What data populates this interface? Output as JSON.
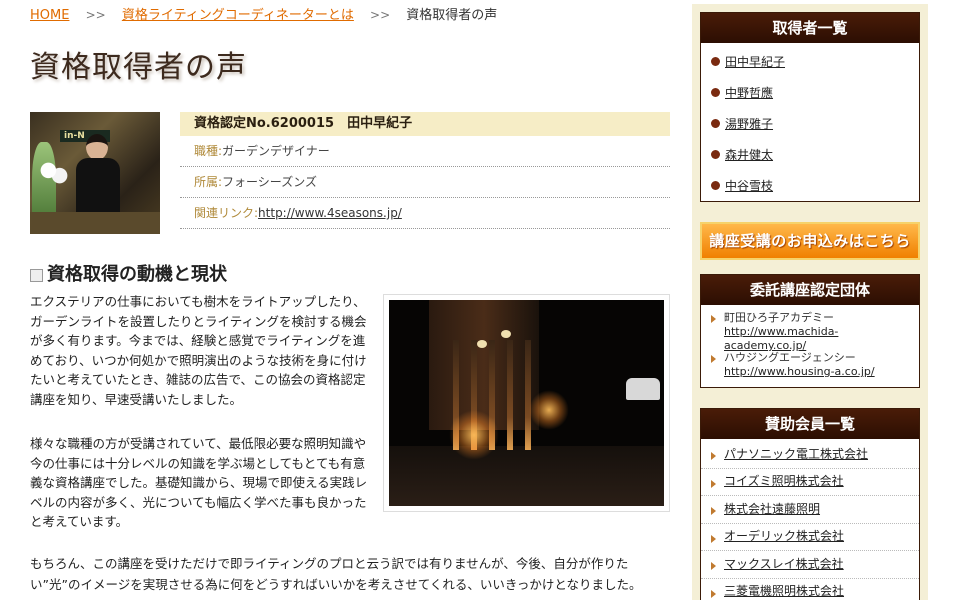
{
  "breadcrumb": {
    "home": "HOME",
    "parent": "資格ライティングコーディネーターとは",
    "current": "資格取得者の声",
    "separator": ">>"
  },
  "page_title": "資格取得者の声",
  "profile": {
    "name_line": "資格認定No.6200015　田中早紀子",
    "occupation_label": "職種:",
    "occupation_value": "ガーデンデザイナー",
    "affiliation_label": "所属:",
    "affiliation_value": "フォーシーズンズ",
    "link_label": "関連リンク:",
    "link_url": "http://www.4seasons.jp/",
    "photo_sign": "in-N"
  },
  "section": {
    "heading": "資格取得の動機と現状",
    "paragraph1": "エクステリアの仕事においても樹木をライトアップしたり、ガーデンライトを設置したりとライティングを検討する機会が多く有ります。今までは、経験と感覚でライティングを進めており、いつか何処かで照明演出のような技術を身に付けたいと考えていたとき、雑誌の広告で、この協会の資格認定講座を知り、早速受講いたしました。",
    "paragraph2": "様々な職種の方が受講されていて、最低限必要な照明知識や今の仕事には十分レベルの知識を学ぶ場としてもとても有意義な資格講座でした。基礎知識から、現場で即使える実践レベルの内容が多く、光についても幅広く学べた事も良かったと考えています。",
    "paragraph3": "もちろん、この講座を受けただけで即ライティングのプロと云う訳では有りませんが、今後、自分が作りたい”光”のイメージを実現させる為に何をどうすればいいかを考えさせてくれる、いいきっかけとなりました。"
  },
  "sidebar": {
    "holders_title": "取得者一覧",
    "holders": [
      "田中早紀子",
      "中野哲應",
      "湯野雅子",
      "森井健太",
      "中谷雪枝"
    ],
    "apply_banner": "講座受講のお申込みはこちら",
    "orgs_title": "委託講座認定団体",
    "orgs": [
      {
        "name": "町田ひろ子アカデミー",
        "url": "http://www.machida-academy.co.jp/"
      },
      {
        "name": "ハウジングエージェンシー",
        "url": "http://www.housing-a.co.jp/"
      }
    ],
    "sponsors_title": "賛助会員一覧",
    "sponsors": [
      "パナソニック電工株式会社",
      "コイズミ照明株式会社",
      "株式会社遠藤照明",
      "オーデリック株式会社",
      "マックスレイ株式会社",
      "三菱電機照明株式会社"
    ]
  }
}
